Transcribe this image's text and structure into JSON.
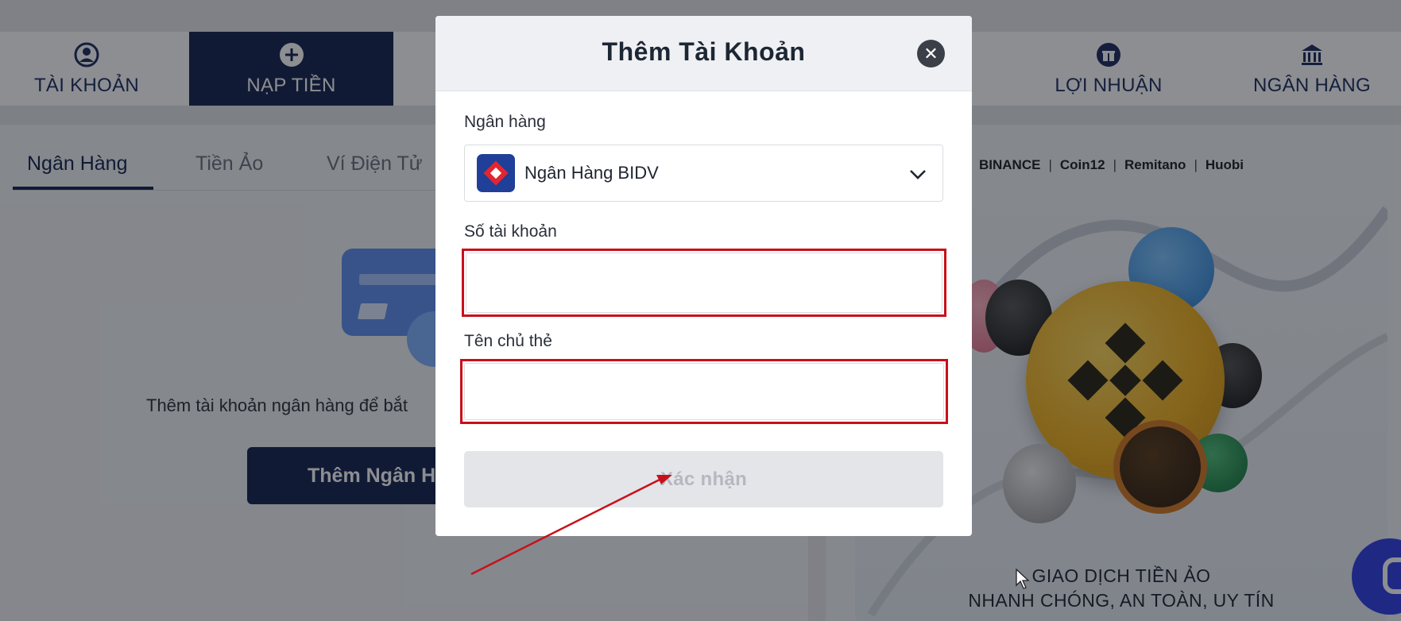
{
  "nav": {
    "items": [
      {
        "label": "TÀI KHOẢN",
        "icon": "user-circle-icon"
      },
      {
        "label": "NẠP TIỀN",
        "icon": "plus-circle-icon"
      },
      {
        "label": "LỢI NHUẬN",
        "icon": "gift-icon"
      },
      {
        "label": "NGÂN HÀNG",
        "icon": "bank-icon"
      }
    ],
    "active": "NẠP TIỀN"
  },
  "tabs": [
    {
      "label": "Ngân Hàng"
    },
    {
      "label": "Tiền Ảo"
    },
    {
      "label": "Ví Điện Tử"
    }
  ],
  "empty_state": {
    "text": "Thêm tài khoản ngân hàng để bắt",
    "button_label": "Thêm Ngân H"
  },
  "promo": {
    "brands": [
      "BINANCE",
      "Coin12",
      "Remitano",
      "Huobi"
    ],
    "line1": "GIAO DỊCH TIỀN ẢO",
    "line2": "NHANH CHÓNG, AN TOÀN, UY TÍN"
  },
  "modal": {
    "title": "Thêm Tài Khoản",
    "bank_label": "Ngân hàng",
    "bank_selected": "Ngân Hàng BIDV",
    "account_label": "Số tài khoản",
    "account_value": "",
    "holder_label": "Tên chủ thẻ",
    "holder_value": "",
    "confirm_label": "Xác nhận",
    "close_icon": "close-icon"
  },
  "colors": {
    "brand_navy": "#14224f",
    "highlight_red": "#c8101b",
    "chat_blue": "#2f3fe6"
  }
}
